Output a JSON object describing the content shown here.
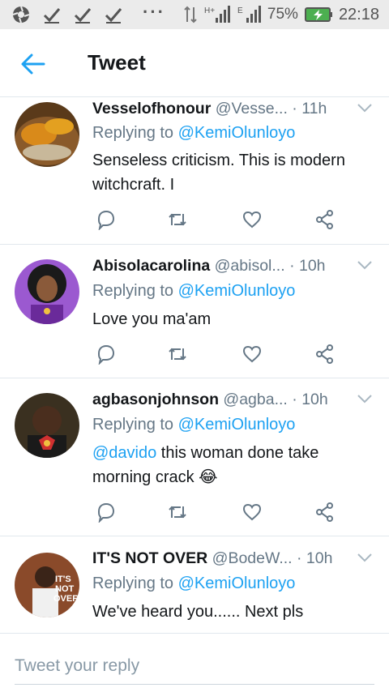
{
  "status_bar": {
    "left_icons": [
      "aperture-icon",
      "check-icon",
      "check-icon",
      "check-icon"
    ],
    "overflow": "···",
    "battery_percent": "75%",
    "time": "22:18"
  },
  "header": {
    "title": "Tweet"
  },
  "tweets": [
    {
      "name": "Vesselofhonour",
      "handle": "@Vesse...",
      "time": "· 11h",
      "reply_prefix": "Replying to ",
      "reply_to": "@KemiOlunloyo",
      "text": "Senseless criticism.  This is modern witchcraft.  I"
    },
    {
      "name": "Abisolacarolina",
      "handle": "@abisol...",
      "time": "· 10h",
      "reply_prefix": "Replying to ",
      "reply_to": "@KemiOlunloyo",
      "text": "Love you ma'am"
    },
    {
      "name": "agbasonjohnson",
      "handle": "@agba...",
      "time": "· 10h",
      "reply_prefix": "Replying to ",
      "reply_to": "@KemiOlunloyo",
      "mention": "@davido",
      "text": " this woman done take morning crack ",
      "emoji": "😂"
    },
    {
      "name": "IT'S NOT OVER",
      "handle": "@BodeW...",
      "time": "· 10h",
      "reply_prefix": "Replying to ",
      "reply_to": "@KemiOlunloyo",
      "text": "We've heard you...... Next pls"
    }
  ],
  "composer": {
    "placeholder": "Tweet your reply"
  },
  "colors": {
    "accent": "#1da1f2",
    "secondary_text": "#657786",
    "divider": "#e1e8ed"
  }
}
